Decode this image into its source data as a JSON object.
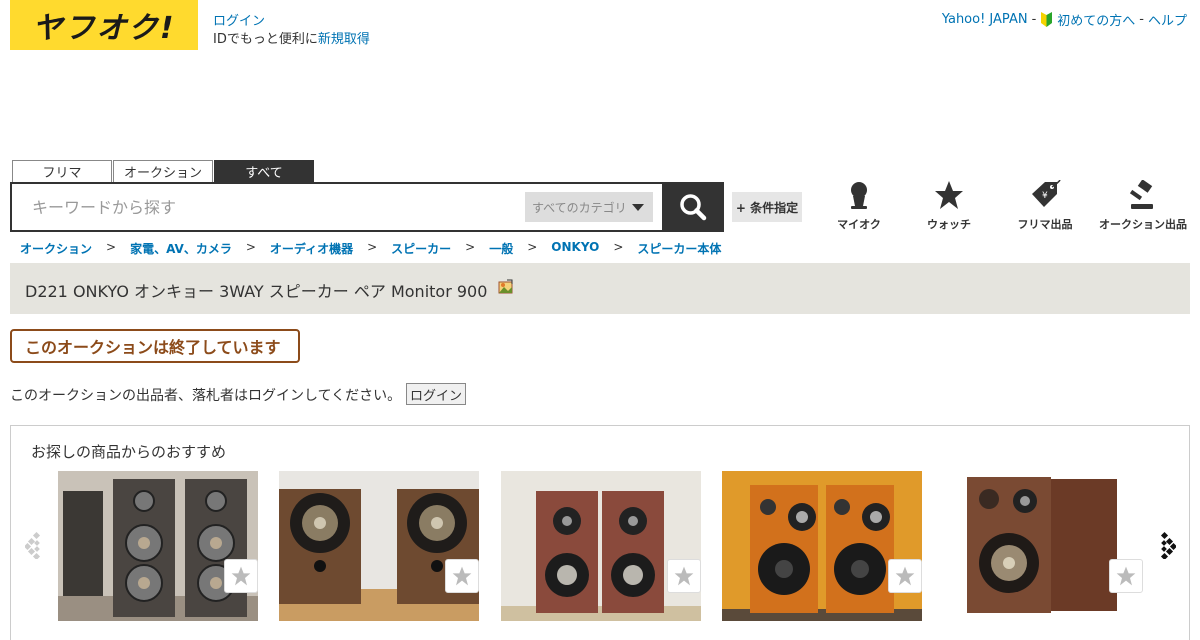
{
  "header": {
    "logo_text": "ヤフオク!",
    "login_label": "ログイン",
    "login_sub_prefix": "IDでもっと便利に",
    "register_label": "新規取得",
    "links": {
      "yahoo_japan": "Yahoo! JAPAN",
      "beginners": "初めての方へ",
      "help": "ヘルプ",
      "separator": "-"
    }
  },
  "tabs": [
    {
      "label": "フリマ",
      "active": false
    },
    {
      "label": "オークション",
      "active": false
    },
    {
      "label": "すべて",
      "active": true
    }
  ],
  "search": {
    "placeholder": "キーワードから探す",
    "value": "",
    "category_label": "すべてのカテゴリ",
    "search_icon": "search-icon",
    "condition_label": "+ 条件指定"
  },
  "nav_icons": [
    {
      "label": "マイオク",
      "icon": "person-icon"
    },
    {
      "label": "ウォッチ",
      "icon": "star-icon"
    },
    {
      "label": "フリマ出品",
      "icon": "price-tag-icon"
    },
    {
      "label": "オークション出品",
      "icon": "gavel-icon"
    }
  ],
  "breadcrumb": {
    "items": [
      "オークション",
      "家電、AV、カメラ",
      "オーディオ機器",
      "スピーカー",
      "一般",
      "ONKYO",
      "スピーカー本体"
    ],
    "separator": ">"
  },
  "item": {
    "title": "D221 ONKYO オンキョー 3WAY スピーカー ペア Monitor 900",
    "status_label": "このオークションは終了しています"
  },
  "notice": {
    "text": "このオークションの出品者、落札者はログインしてください。",
    "button_label": "ログイン"
  },
  "recommendations": {
    "title": "お探しの商品からのおすすめ",
    "items": [
      {
        "image": "tall-dark-3way-speakers-photo"
      },
      {
        "image": "walnut-bookshelf-speakers-photo"
      },
      {
        "image": "brown-compact-speakers-photo"
      },
      {
        "image": "orange-wooden-speakers-photo"
      },
      {
        "image": "single-brown-speaker-photo"
      }
    ]
  },
  "colors": {
    "brand_yellow": "#ffda2e",
    "link_blue": "#0073b3",
    "dark": "#333333",
    "title_bar_bg": "#e5e4de",
    "ended_brown": "#8c4b1a"
  }
}
